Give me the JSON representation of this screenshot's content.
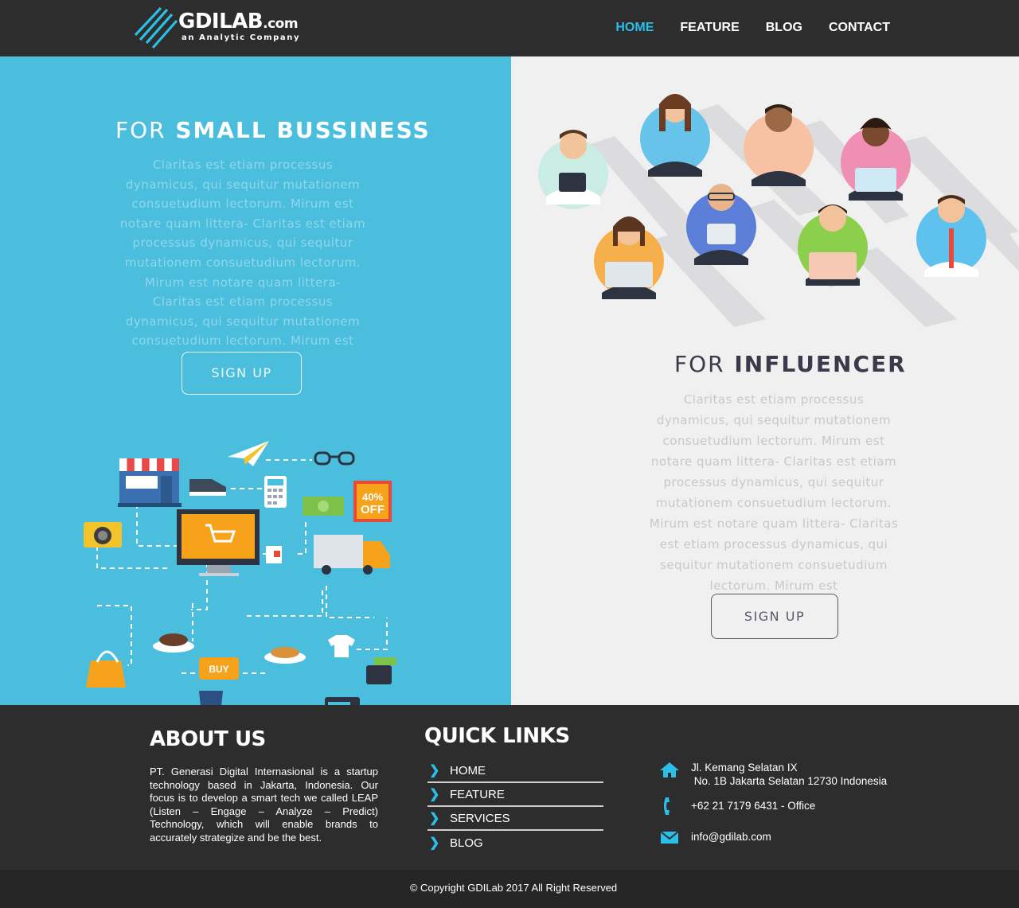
{
  "brand": {
    "name": "GDILAB",
    "suffix": ".com",
    "tagline": "an Analytic Company",
    "accent": "#2bbfe8"
  },
  "nav": {
    "items": [
      {
        "label": "HOME",
        "active": true
      },
      {
        "label": "FEATURE",
        "active": false
      },
      {
        "label": "BLOG",
        "active": false
      },
      {
        "label": "CONTACT",
        "active": false
      }
    ]
  },
  "small_business": {
    "title_light": "FOR",
    "title_bold": "SMALL BUSSINESS",
    "text": "Claritas est etiam processus dynamicus, qui sequitur mutationem consuetudium lectorum. Mirum est notare quam littera- Claritas est etiam processus dynamicus, qui sequitur mutationem consuetudium lectorum. Mirum est notare quam littera- Claritas est etiam processus dynamicus, qui sequitur mutationem consuetudium lectorum. Mirum est",
    "button": "SIGN UP",
    "badge_top": "40%",
    "badge_bottom": "OFF",
    "buy_label": "BUY",
    "bg_color": "#4bbede"
  },
  "influencer": {
    "title_light": "FOR",
    "title_bold": "INFLUENCER",
    "text": "Claritas est etiam processus dynamicus, qui sequitur mutationem consuetudium lectorum. Mirum est notare quam littera- Claritas est etiam processus dynamicus, qui sequitur mutationem consuetudium lectorum. Mirum est notare quam littera- Claritas est etiam processus dynamicus, qui sequitur mutationem consuetudium lectorum. Mirum est",
    "button": "SIGN UP",
    "bg_color": "#f0f0f0"
  },
  "footer": {
    "about_title": "ABOUT US",
    "about_text": "PT. Generasi Digital Internasional is a startup technology based in Jakarta, Indonesia. Our focus is to develop a smart tech we called LEAP (Listen – Engage – Analyze – Predict) Technology, which will enable brands to accurately strategize and be the best.",
    "quick_links_title": "QUICK LINKS",
    "quick_links": [
      "HOME",
      "FEATURE",
      "SERVICES",
      "BLOG"
    ],
    "address_line1": "Jl. Kemang Selatan IX",
    "address_line2": " No. 1B Jakarta Selatan 12730 Indonesia",
    "phone": "+62 21 7179 6431 - Office",
    "email": "info@gdilab.com",
    "copyright": "© Copyright GDILab 2017 All Right Reserved"
  }
}
